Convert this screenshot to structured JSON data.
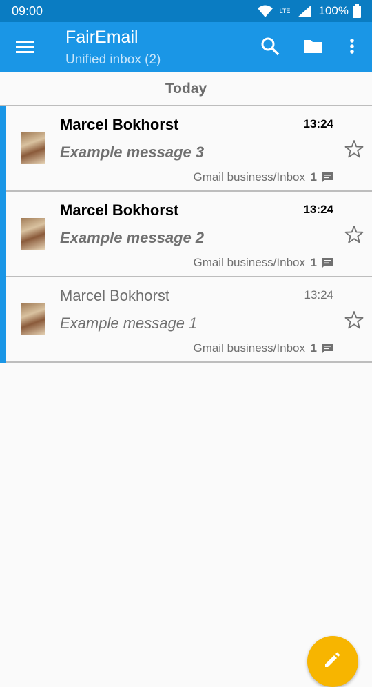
{
  "status_bar": {
    "time": "09:00",
    "network": "LTE",
    "battery": "100%"
  },
  "app_bar": {
    "title": "FairEmail",
    "subtitle": "Unified inbox (2)",
    "icons": [
      "menu-icon",
      "search-icon",
      "folder-icon",
      "more-vert-icon"
    ]
  },
  "list": {
    "section_header": "Today",
    "messages": [
      {
        "sender": "Marcel Bokhorst",
        "time": "13:24",
        "subject": "Example message 3",
        "folder": "Gmail business/Inbox",
        "thread_count": "1",
        "unread": true
      },
      {
        "sender": "Marcel Bokhorst",
        "time": "13:24",
        "subject": "Example message 2",
        "folder": "Gmail business/Inbox",
        "thread_count": "1",
        "unread": true
      },
      {
        "sender": "Marcel Bokhorst",
        "time": "13:24",
        "subject": "Example message 1",
        "folder": "Gmail business/Inbox",
        "thread_count": "1",
        "unread": false
      }
    ]
  },
  "colors": {
    "status_bar": "#0a7cc2",
    "app_bar": "#1a96e6",
    "unread_indicator": "#1a96e6",
    "fab": "#f7b500"
  },
  "fab": {
    "icon": "edit-icon"
  }
}
